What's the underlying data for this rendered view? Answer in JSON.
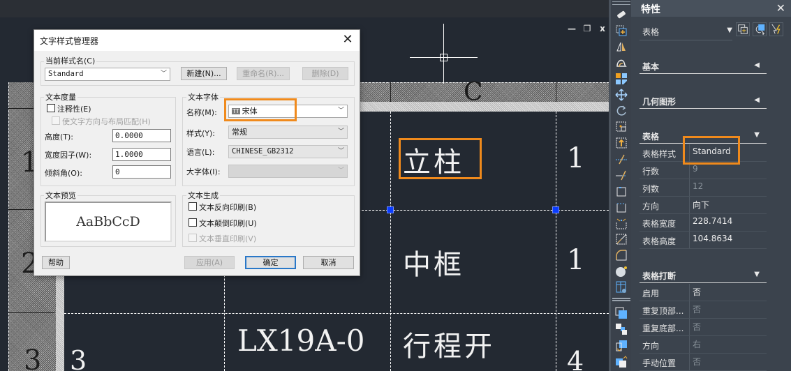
{
  "viewport": {
    "controls": {
      "minimize": "—",
      "restore": "❐",
      "close": "x"
    },
    "header_letter": "C",
    "row_numbers": [
      "1",
      "2",
      "3"
    ],
    "cells": {
      "r1_name": "立柱",
      "r1_qty": "1",
      "r2_name": "中框",
      "r2_qty": "1",
      "r3_index": "3",
      "r3_model": "LX19A-0",
      "r3_name": "行程开",
      "r3_qty": "4"
    }
  },
  "dialog": {
    "title": "文字样式管理器",
    "close": "✕",
    "current_style": {
      "label": "当前样式名(C)",
      "value": "Standard",
      "new_btn": "新建(N)...",
      "rename_btn": "重命名(R)...",
      "delete_btn": "删除(D)"
    },
    "metrics": {
      "label": "文本度量",
      "annotative": "注释性(E)",
      "match_layout": "使文字方向与布局匹配(H)",
      "height_label": "高度(T):",
      "height_value": "0.0000",
      "width_label": "宽度因子(W):",
      "width_value": "1.0000",
      "oblique_label": "倾斜角(O):",
      "oblique_value": "0"
    },
    "font": {
      "label": "文本字体",
      "name_label": "名称(M):",
      "name_value": "宋体",
      "name_icon": "TT",
      "style_label": "样式(Y):",
      "style_value": "常规",
      "lang_label": "语言(L):",
      "lang_value": "CHINESE_GB2312",
      "bigfont_label": "大字体(I):",
      "bigfont_value": ""
    },
    "preview": {
      "label": "文本预览",
      "text": "AaBbCcD"
    },
    "generation": {
      "label": "文本生成",
      "backwards": "文本反向印刷(B)",
      "upside_down": "文本颠倒印刷(U)",
      "vertical": "文本垂直印刷(V)"
    },
    "buttons": {
      "help": "帮助",
      "apply": "应用(A)",
      "ok": "确定",
      "cancel": "取消"
    },
    "highlight_color": "#f08a1c"
  },
  "properties": {
    "title": "特性",
    "close": "✕",
    "object_type": "表格",
    "sections": {
      "basic": "基本",
      "geometry": "几何图形",
      "table": "表格",
      "table_break": "表格打断"
    },
    "table_rows": [
      {
        "key": "表格样式",
        "value": "Standard",
        "dim": false
      },
      {
        "key": "行数",
        "value": "9",
        "dim": true
      },
      {
        "key": "列数",
        "value": "12",
        "dim": true
      },
      {
        "key": "方向",
        "value": "向下",
        "dim": false
      },
      {
        "key": "表格宽度",
        "value": "228.7414",
        "dim": false
      },
      {
        "key": "表格高度",
        "value": "104.8634",
        "dim": false
      }
    ],
    "break_rows": [
      {
        "key": "启用",
        "value": "否",
        "dim": false
      },
      {
        "key": "重复顶部...",
        "value": "否",
        "dim": true
      },
      {
        "key": "重复底部...",
        "value": "否",
        "dim": true
      },
      {
        "key": "方向",
        "value": "右",
        "dim": true
      },
      {
        "key": "手动位置",
        "value": "否",
        "dim": true
      }
    ]
  },
  "colors": {
    "canvas_bg": "#232932",
    "panel_bg": "#3b434d",
    "accent_orange": "#f08a1c",
    "grip_blue": "#0a3cff"
  }
}
